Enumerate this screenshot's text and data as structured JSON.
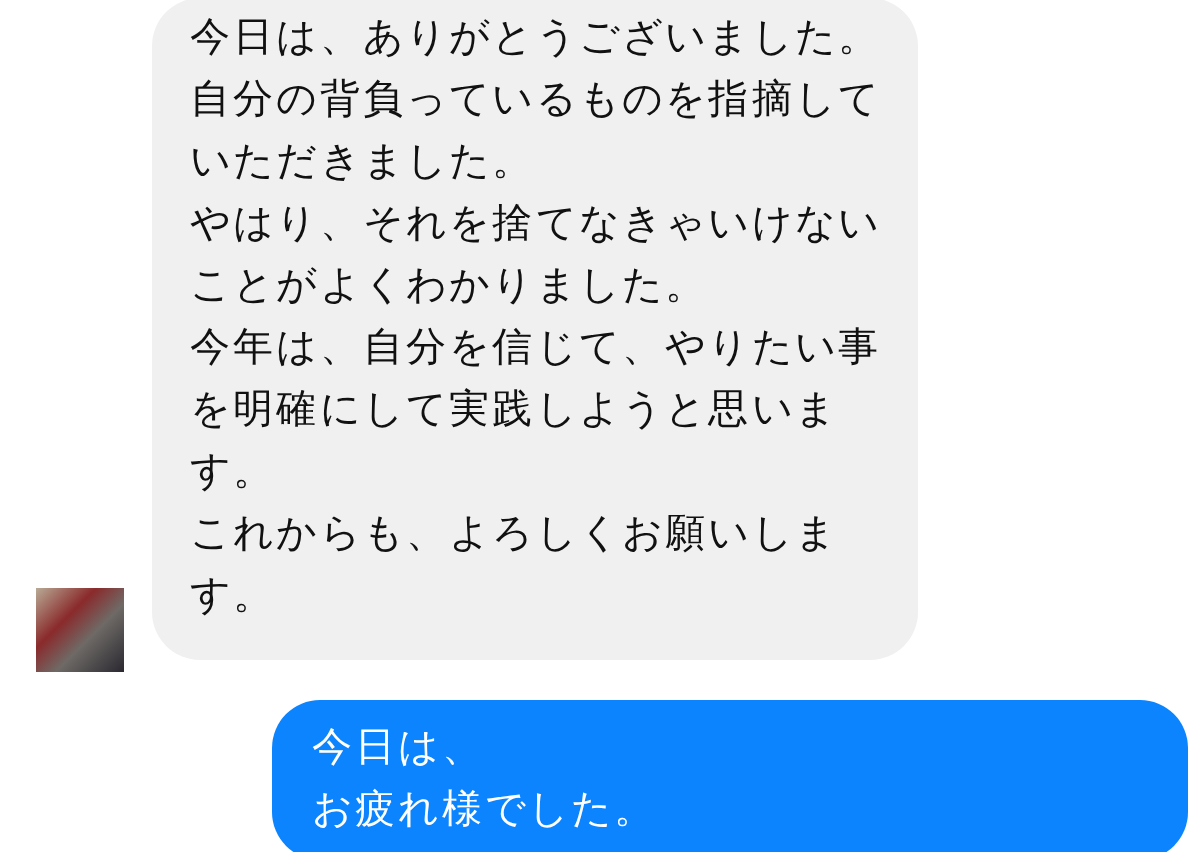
{
  "messages": [
    {
      "kind": "received",
      "lines": [
        "今日は、ありがとうございました。",
        "自分の背負っているものを指摘して",
        "いただきました。",
        "やはり、それを捨てなきゃいけない",
        "ことがよくわかりました。",
        "今年は、自分を信じて、やりたい事",
        "を明確にして実践しようと思いま",
        "す。",
        "これからも、よろしくお願いしま",
        "す。"
      ]
    },
    {
      "kind": "sent",
      "lines": [
        "今日は、",
        "お疲れ様でした。"
      ]
    }
  ]
}
